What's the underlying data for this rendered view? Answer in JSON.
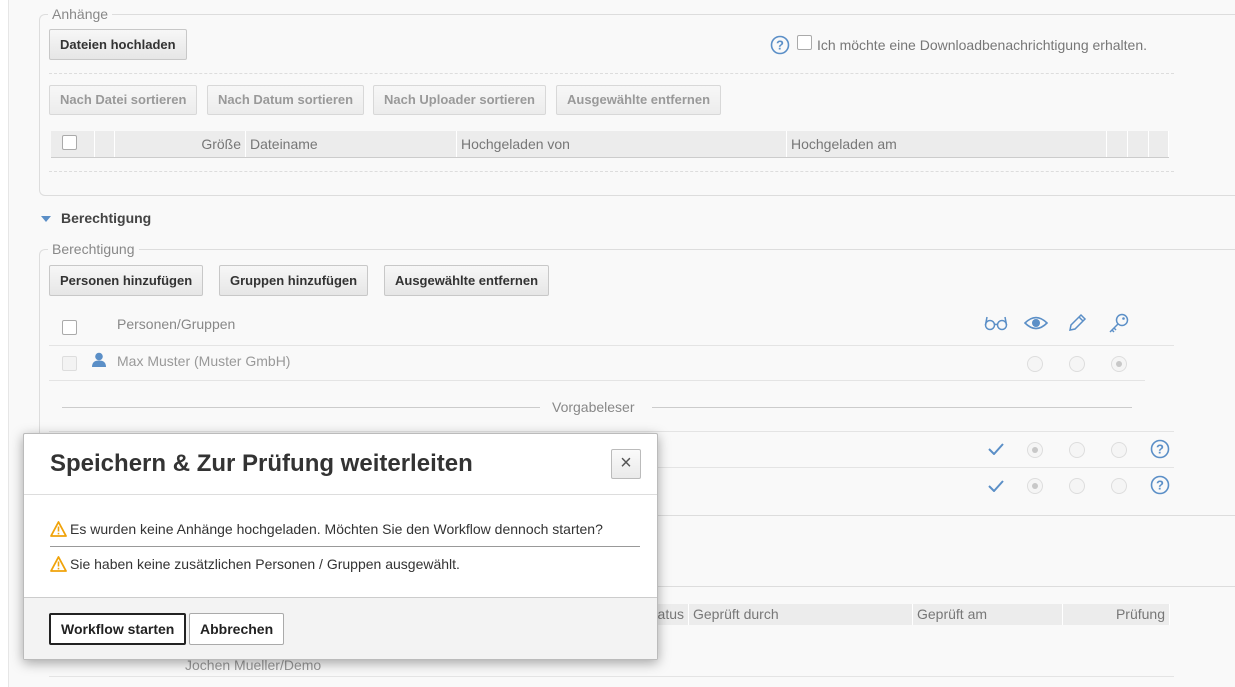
{
  "attachments": {
    "legend": "Anhänge",
    "upload_button": "Dateien hochladen",
    "notify_label": "Ich möchte eine Downloadbenachrichtigung erhalten.",
    "sort_buttons": [
      "Nach Datei sortieren",
      "Nach Datum sortieren",
      "Nach Uploader sortieren",
      "Ausgewählte entfernen"
    ],
    "columns": [
      "Größe",
      "Dateiname",
      "Hochgeladen von",
      "Hochgeladen am"
    ]
  },
  "permissions": {
    "section_title": "Berechtigung",
    "legend": "Berechtigung",
    "add_persons_button": "Personen hinzufügen",
    "add_groups_button": "Gruppen hinzufügen",
    "remove_selected_button": "Ausgewählte entfernen",
    "column_header": "Personen/Gruppen",
    "rows": [
      {
        "name": "Max Muster (Muster GmbH)"
      }
    ],
    "divider_label": "Vorgabeleser"
  },
  "review_table": {
    "columns": [
      "atus",
      "Geprüft durch",
      "Geprüft am",
      "Prüfung"
    ],
    "row_name": "Jochen Mueller/Demo"
  },
  "dialog": {
    "title": "Speichern & Zur Prüfung weiterleiten",
    "close": "×",
    "messages": [
      "Es wurden keine Anhänge hochgeladen. Möchten Sie den Workflow dennoch starten?",
      "Sie haben keine zusätzlichen Personen / Gruppen ausgewählt."
    ],
    "start_button": "Workflow starten",
    "cancel_button": "Abbrechen"
  },
  "colors": {
    "accent": "#5b8fc7",
    "warning": "#f0a30a"
  }
}
